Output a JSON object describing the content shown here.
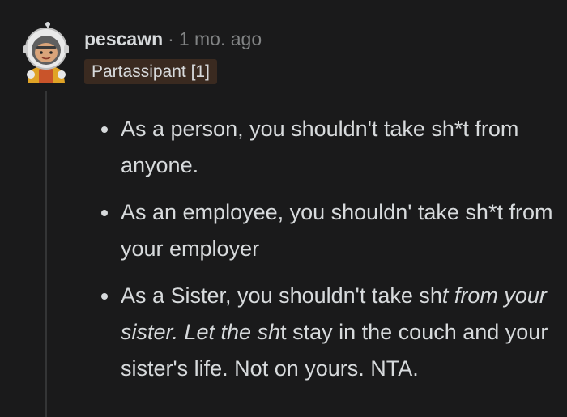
{
  "comment": {
    "username": "pescawn",
    "separator": "·",
    "time": "1 mo. ago",
    "flair": "Partassipant [1]",
    "bullets": [
      {
        "text": "As a person, you shouldn't take sh*t from anyone."
      },
      {
        "text": "As an employee, you shouldn' take sh*t from your employer"
      },
      {
        "part1": "As a Sister, you shouldn't take sh",
        "part2_italic": "t from your sister. Let the sh",
        "part3": "t stay in the couch and your sister's life. Not on yours. NTA."
      }
    ]
  },
  "colors": {
    "background": "#1a1a1b",
    "text": "#d7dadc",
    "meta": "#818384",
    "flair_bg": "#3a2a20",
    "thread_line": "#343536"
  },
  "icons": {
    "avatar": "astronaut-avatar-icon"
  }
}
